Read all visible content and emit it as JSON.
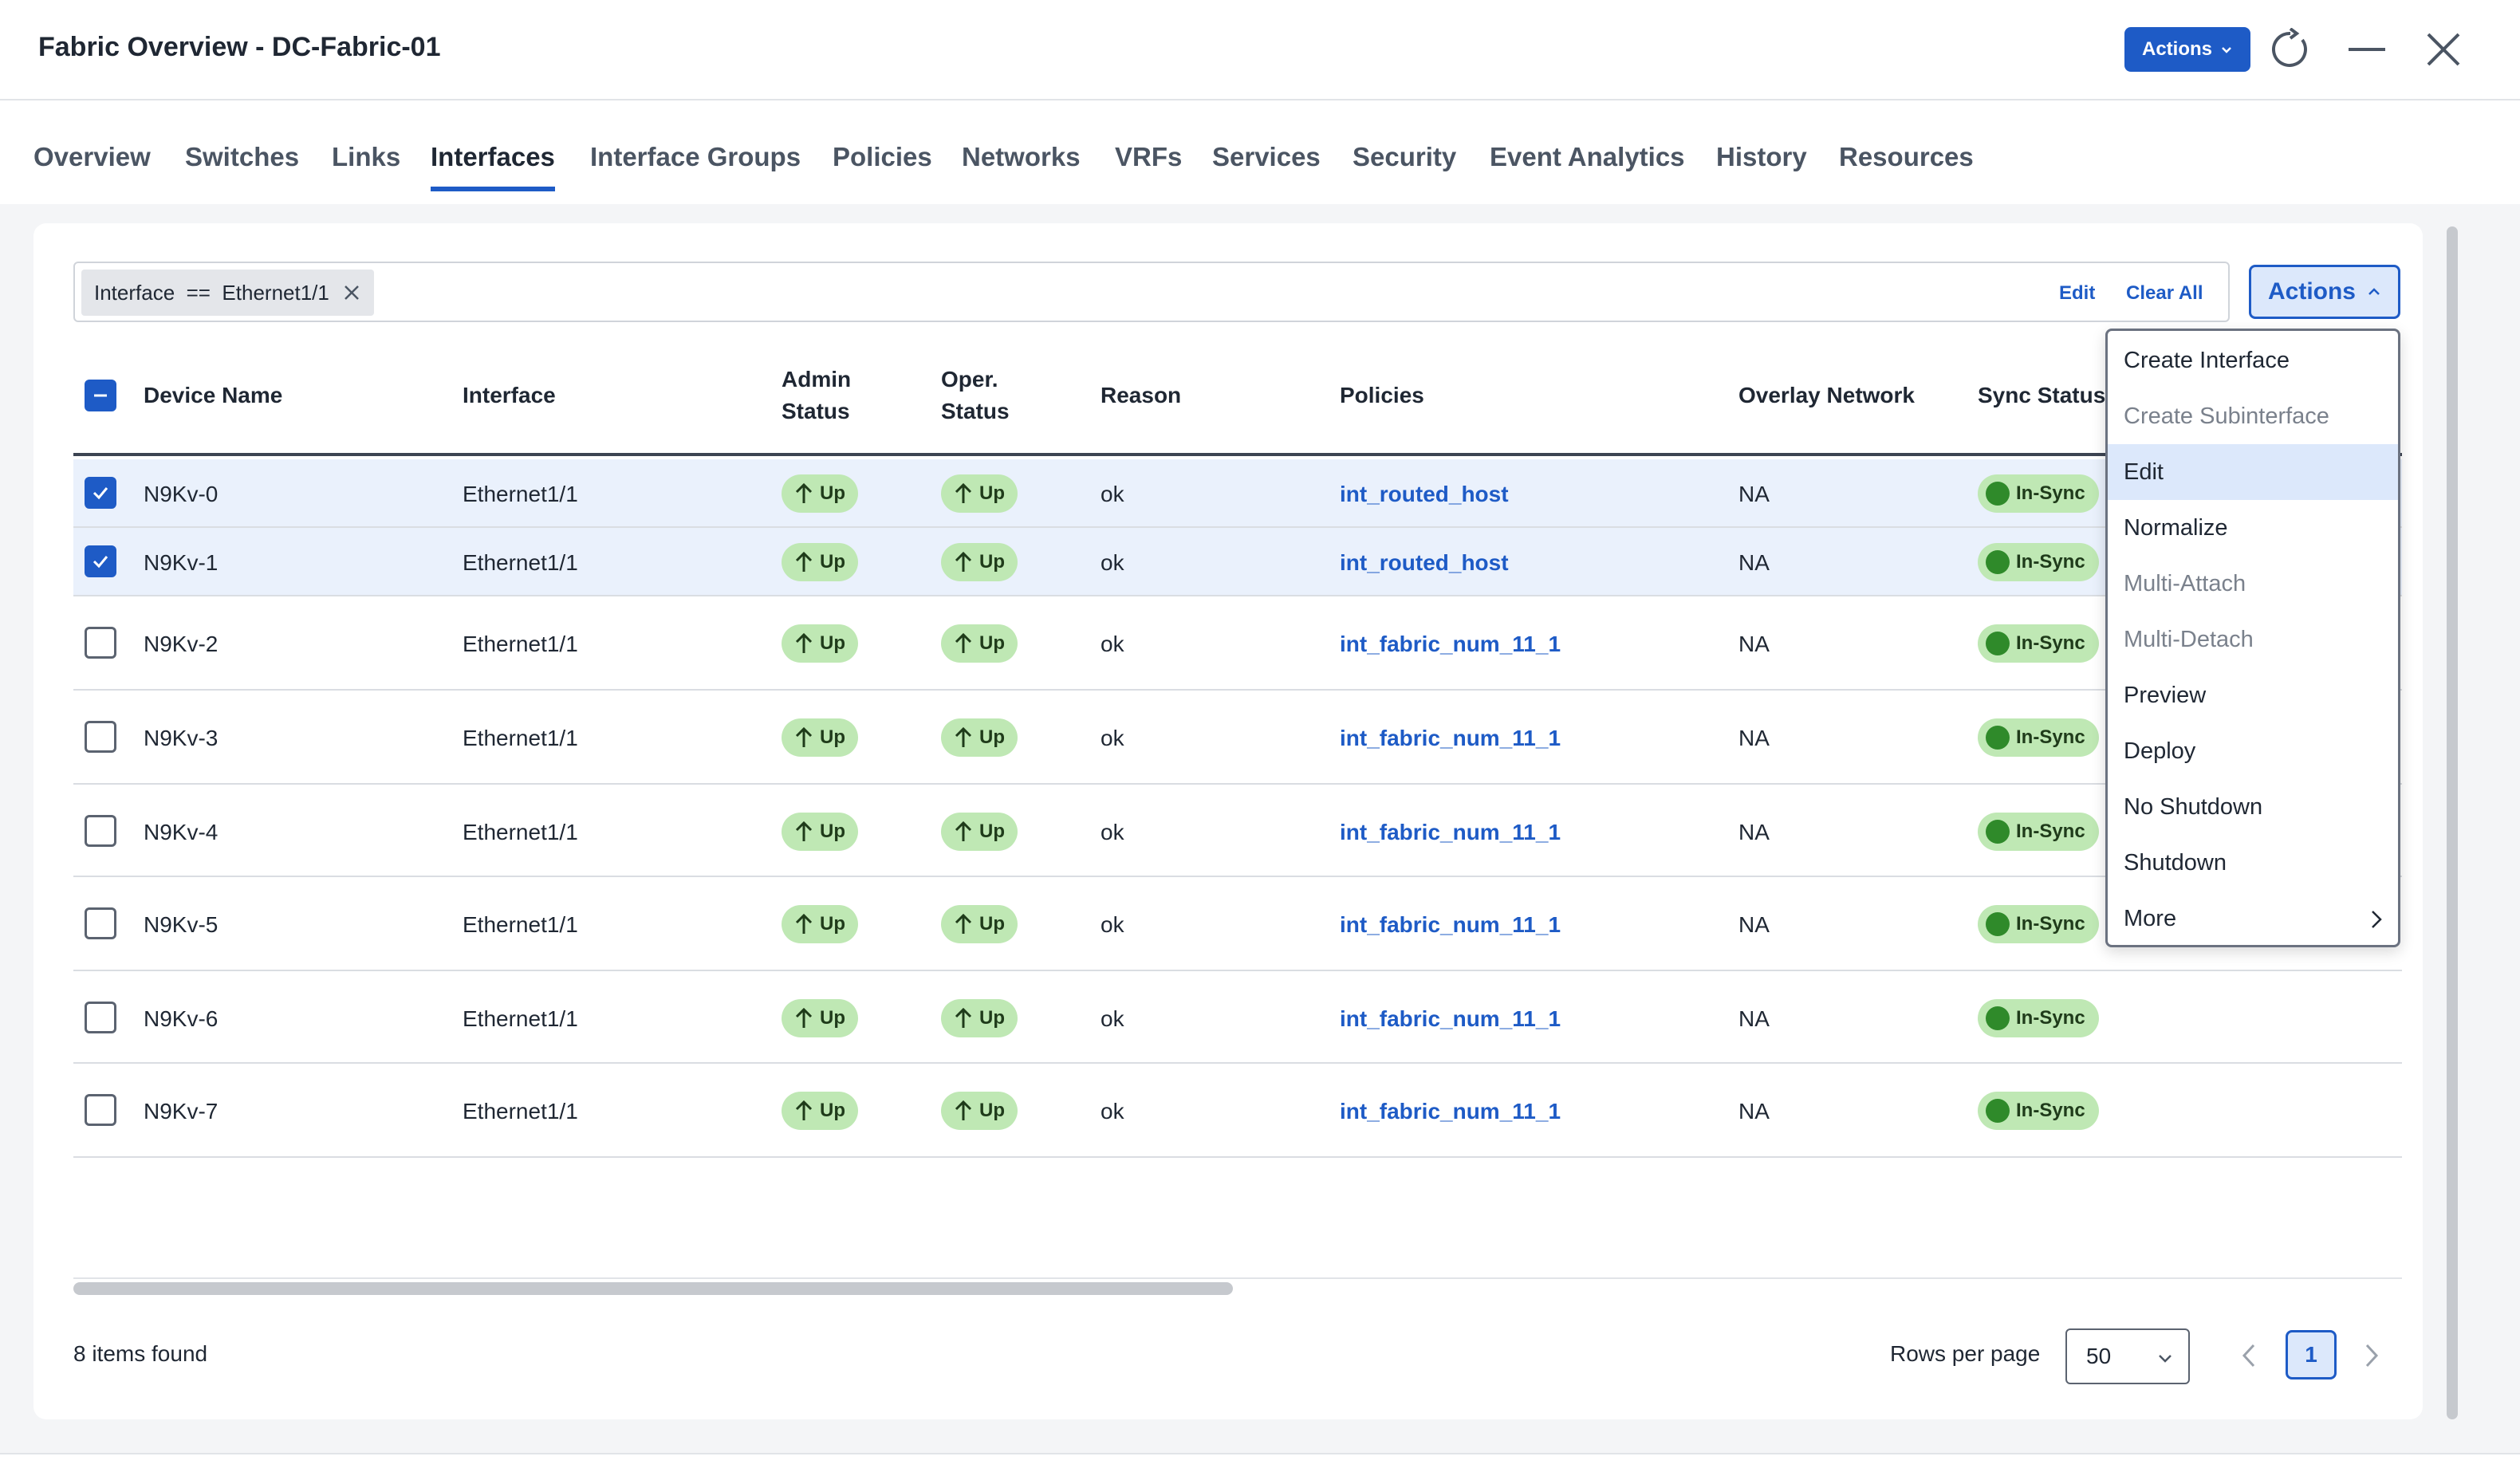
{
  "header": {
    "title": "Fabric Overview - DC-Fabric-01",
    "actions_label": "Actions",
    "icons": [
      "refresh-icon",
      "minimize-icon",
      "close-icon"
    ]
  },
  "tabs": [
    {
      "label": "Overview"
    },
    {
      "label": "Switches"
    },
    {
      "label": "Links"
    },
    {
      "label": "Interfaces",
      "active": true
    },
    {
      "label": "Interface Groups"
    },
    {
      "label": "Policies"
    },
    {
      "label": "Networks"
    },
    {
      "label": "VRFs"
    },
    {
      "label": "Services"
    },
    {
      "label": "Security"
    },
    {
      "label": "Event Analytics"
    },
    {
      "label": "History"
    },
    {
      "label": "Resources"
    }
  ],
  "filter": {
    "chip": "Interface  ==  Ethernet1/1",
    "edit_label": "Edit",
    "clear_label": "Clear All"
  },
  "toolbar": {
    "actions_label": "Actions"
  },
  "table": {
    "headers": {
      "device": "Device Name",
      "interface": "Interface",
      "admin_1": "Admin",
      "admin_2": "Status",
      "oper_1": "Oper.",
      "oper_2": "Status",
      "reason": "Reason",
      "policies": "Policies",
      "overlay": "Overlay Network",
      "sync": "Sync Status"
    },
    "rows": [
      {
        "device": "N9Kv-0",
        "interface": "Ethernet1/1",
        "admin": "Up",
        "oper": "Up",
        "reason": "ok",
        "policy": "int_routed_host",
        "overlay": "NA",
        "sync": "In-Sync",
        "checked": true
      },
      {
        "device": "N9Kv-1",
        "interface": "Ethernet1/1",
        "admin": "Up",
        "oper": "Up",
        "reason": "ok",
        "policy": "int_routed_host",
        "overlay": "NA",
        "sync": "In-Sync",
        "checked": true
      },
      {
        "device": "N9Kv-2",
        "interface": "Ethernet1/1",
        "admin": "Up",
        "oper": "Up",
        "reason": "ok",
        "policy": "int_fabric_num_11_1",
        "overlay": "NA",
        "sync": "In-Sync",
        "checked": false
      },
      {
        "device": "N9Kv-3",
        "interface": "Ethernet1/1",
        "admin": "Up",
        "oper": "Up",
        "reason": "ok",
        "policy": "int_fabric_num_11_1",
        "overlay": "NA",
        "sync": "In-Sync",
        "checked": false
      },
      {
        "device": "N9Kv-4",
        "interface": "Ethernet1/1",
        "admin": "Up",
        "oper": "Up",
        "reason": "ok",
        "policy": "int_fabric_num_11_1",
        "overlay": "NA",
        "sync": "In-Sync",
        "checked": false
      },
      {
        "device": "N9Kv-5",
        "interface": "Ethernet1/1",
        "admin": "Up",
        "oper": "Up",
        "reason": "ok",
        "policy": "int_fabric_num_11_1",
        "overlay": "NA",
        "sync": "In-Sync",
        "checked": false
      },
      {
        "device": "N9Kv-6",
        "interface": "Ethernet1/1",
        "admin": "Up",
        "oper": "Up",
        "reason": "ok",
        "policy": "int_fabric_num_11_1",
        "overlay": "NA",
        "sync": "In-Sync",
        "checked": false
      },
      {
        "device": "N9Kv-7",
        "interface": "Ethernet1/1",
        "admin": "Up",
        "oper": "Up",
        "reason": "ok",
        "policy": "int_fabric_num_11_1",
        "overlay": "NA",
        "sync": "In-Sync",
        "checked": false
      }
    ]
  },
  "menu": {
    "items": [
      {
        "label": "Create Interface",
        "state": "enabled"
      },
      {
        "label": "Create Subinterface",
        "state": "disabled"
      },
      {
        "label": "Edit",
        "state": "highlighted"
      },
      {
        "label": "Normalize",
        "state": "enabled"
      },
      {
        "label": "Multi-Attach",
        "state": "disabled"
      },
      {
        "label": "Multi-Detach",
        "state": "disabled"
      },
      {
        "label": "Preview",
        "state": "enabled"
      },
      {
        "label": "Deploy",
        "state": "enabled"
      },
      {
        "label": "No Shutdown",
        "state": "enabled"
      },
      {
        "label": "Shutdown",
        "state": "enabled"
      },
      {
        "label": "More",
        "state": "submenu"
      }
    ]
  },
  "footer": {
    "count": "8 items found",
    "rows_label": "Rows per page",
    "rows_value": "50",
    "page": "1"
  },
  "colors": {
    "accent": "#1e5bc6",
    "status_badge": "#bfe8b4",
    "sync_dot": "#2f8a2a",
    "selected_row": "#eaf1fc"
  }
}
